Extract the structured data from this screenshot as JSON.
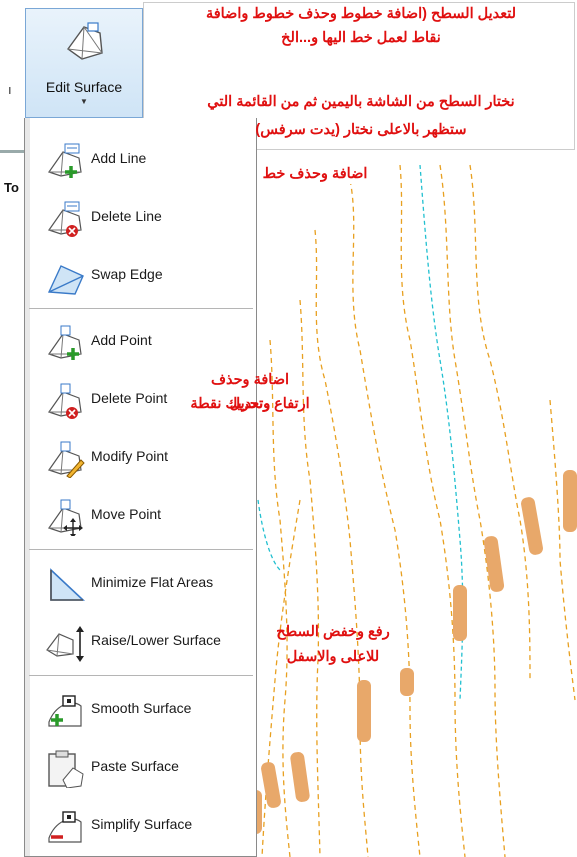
{
  "notes": {
    "top_line1": "لتعديل السطح (اضافة خطوط وحذف خطوط واضافة",
    "top_line2": "نقاط لعمل خط اليها و...الخ",
    "top_line3": "نختار السطح من الشاشة باليمين ثم من القائمة التي",
    "top_line4": "ستظهر بالاعلى نختار (يدت سرفس)",
    "add_delete_line": "اضافة وحذف خط",
    "points_line1": "اضافة وحذف وتعديل",
    "points_line2": "ارتفاع وتحريك نقطة",
    "raise_line1": "رفع وخفض السطح",
    "raise_line2": "للاعلى والاسفل"
  },
  "ribbon": {
    "edit_surface_label": "Edit Surface",
    "caret": "▼",
    "side_mark": "ı",
    "partial_label": "To"
  },
  "menu": {
    "items": [
      {
        "label": "Add Line",
        "icon": "add-line-icon"
      },
      {
        "label": "Delete Line",
        "icon": "delete-line-icon"
      },
      {
        "label": "Swap Edge",
        "icon": "swap-edge-icon"
      },
      {
        "label": "Add Point",
        "icon": "add-point-icon"
      },
      {
        "label": "Delete Point",
        "icon": "delete-point-icon"
      },
      {
        "label": "Modify Point",
        "icon": "modify-point-icon"
      },
      {
        "label": "Move Point",
        "icon": "move-point-icon"
      },
      {
        "label": "Minimize Flat Areas",
        "icon": "minimize-flat-areas-icon"
      },
      {
        "label": "Raise/Lower Surface",
        "icon": "raise-lower-surface-icon"
      },
      {
        "label": "Smooth Surface",
        "icon": "smooth-surface-icon"
      },
      {
        "label": "Paste Surface",
        "icon": "paste-surface-icon"
      },
      {
        "label": "Simplify Surface",
        "icon": "simplify-surface-icon"
      }
    ]
  },
  "colors": {
    "note_red": "#e01010",
    "contour_orange": "#e8a020",
    "contour_cyan": "#22c0d0",
    "label_bg": "#e8a86a",
    "plus_green": "#2a9a2a",
    "delete_red": "#d02020"
  }
}
